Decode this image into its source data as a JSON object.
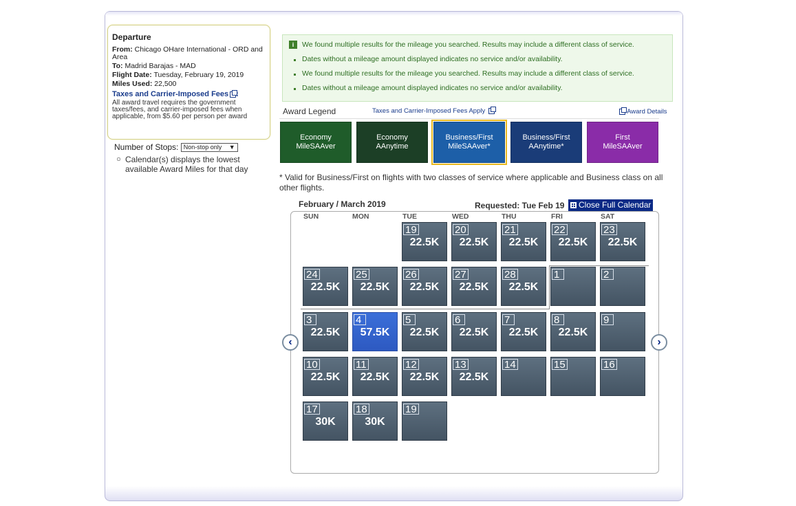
{
  "summary": {
    "heading": "Departure",
    "from_label": "From:",
    "from_value": "Chicago OHare International - ORD and Area",
    "to_label": "To:",
    "to_value": "Madrid Barajas - MAD",
    "date_label": "Flight Date:",
    "date_value": "Tuesday, February 19, 2019",
    "miles_label": "Miles Used:",
    "miles_value": "22,500",
    "fees_link": "Taxes and Carrier-Imposed Fees",
    "fees_text": "All award travel requires the government taxes/fees, and carrier-imposed fees when applicable, from $5.60 per person per award"
  },
  "stops": {
    "label": "Number of Stops:",
    "value": "Non-stop only",
    "arrow": "▼"
  },
  "calendar_note": "Calendar(s) displays the lowest available Award Miles for that day",
  "notices": {
    "info_glyph": "i",
    "lines": [
      "We found multiple results for the mileage you searched. Results may include a different class of service.",
      "Dates without a mileage amount displayed indicates no service and/or availability.",
      "We found multiple results for the mileage you searched. Results may include a different class of service.",
      "Dates without a mileage amount displayed indicates no service and/or availability."
    ]
  },
  "legend": {
    "title": "Award Legend",
    "fees_link": "Taxes and Carrier-Imposed Fees Apply",
    "details_link": "Award Details",
    "buttons": [
      {
        "line1": "Economy",
        "line2": "MileSAAver",
        "color": "#1f5c2a"
      },
      {
        "line1": "Economy",
        "line2": "AAnytime",
        "color": "#1c3f26"
      },
      {
        "line1": "Business/First",
        "line2": "MileSAAver*",
        "color": "#1d5fa8"
      },
      {
        "line1": "Business/First",
        "line2": "AAnytime*",
        "color": "#1a3c78"
      },
      {
        "line1": "First",
        "line2": "MileSAAver",
        "color": "#8a2ca8"
      }
    ],
    "valid_note": "* Valid for Business/First on flights with two classes of service where applicable and Business class on all other flights."
  },
  "calendar": {
    "month_label": "February / March 2019",
    "requested": "Requested: Tue Feb 19",
    "close_label": "Close Full Calendar",
    "prev_glyph": "‹",
    "next_glyph": "›",
    "days_of_week": [
      "SUN",
      "MON",
      "TUE",
      "WED",
      "THU",
      "FRI",
      "SAT"
    ],
    "cells": [
      {
        "day": "19",
        "miles": "22.5K"
      },
      {
        "day": "20",
        "miles": "22.5K"
      },
      {
        "day": "21",
        "miles": "22.5K"
      },
      {
        "day": "22",
        "miles": "22.5K"
      },
      {
        "day": "23",
        "miles": "22.5K"
      },
      {
        "day": "24",
        "miles": "22.5K"
      },
      {
        "day": "25",
        "miles": "22.5K"
      },
      {
        "day": "26",
        "miles": "22.5K"
      },
      {
        "day": "27",
        "miles": "22.5K"
      },
      {
        "day": "28",
        "miles": "22.5K"
      },
      {
        "day": "1",
        "miles": ""
      },
      {
        "day": "2",
        "miles": ""
      },
      {
        "day": "3",
        "miles": "22.5K"
      },
      {
        "day": "4",
        "miles": "57.5K",
        "selected": true
      },
      {
        "day": "5",
        "miles": "22.5K"
      },
      {
        "day": "6",
        "miles": "22.5K"
      },
      {
        "day": "7",
        "miles": "22.5K"
      },
      {
        "day": "8",
        "miles": "22.5K"
      },
      {
        "day": "9",
        "miles": ""
      },
      {
        "day": "10",
        "miles": "22.5K"
      },
      {
        "day": "11",
        "miles": "22.5K"
      },
      {
        "day": "12",
        "miles": "22.5K"
      },
      {
        "day": "13",
        "miles": "22.5K"
      },
      {
        "day": "14",
        "miles": ""
      },
      {
        "day": "15",
        "miles": ""
      },
      {
        "day": "16",
        "miles": ""
      },
      {
        "day": "17",
        "miles": "30K"
      },
      {
        "day": "18",
        "miles": "30K"
      },
      {
        "day": "19",
        "miles": ""
      }
    ]
  }
}
